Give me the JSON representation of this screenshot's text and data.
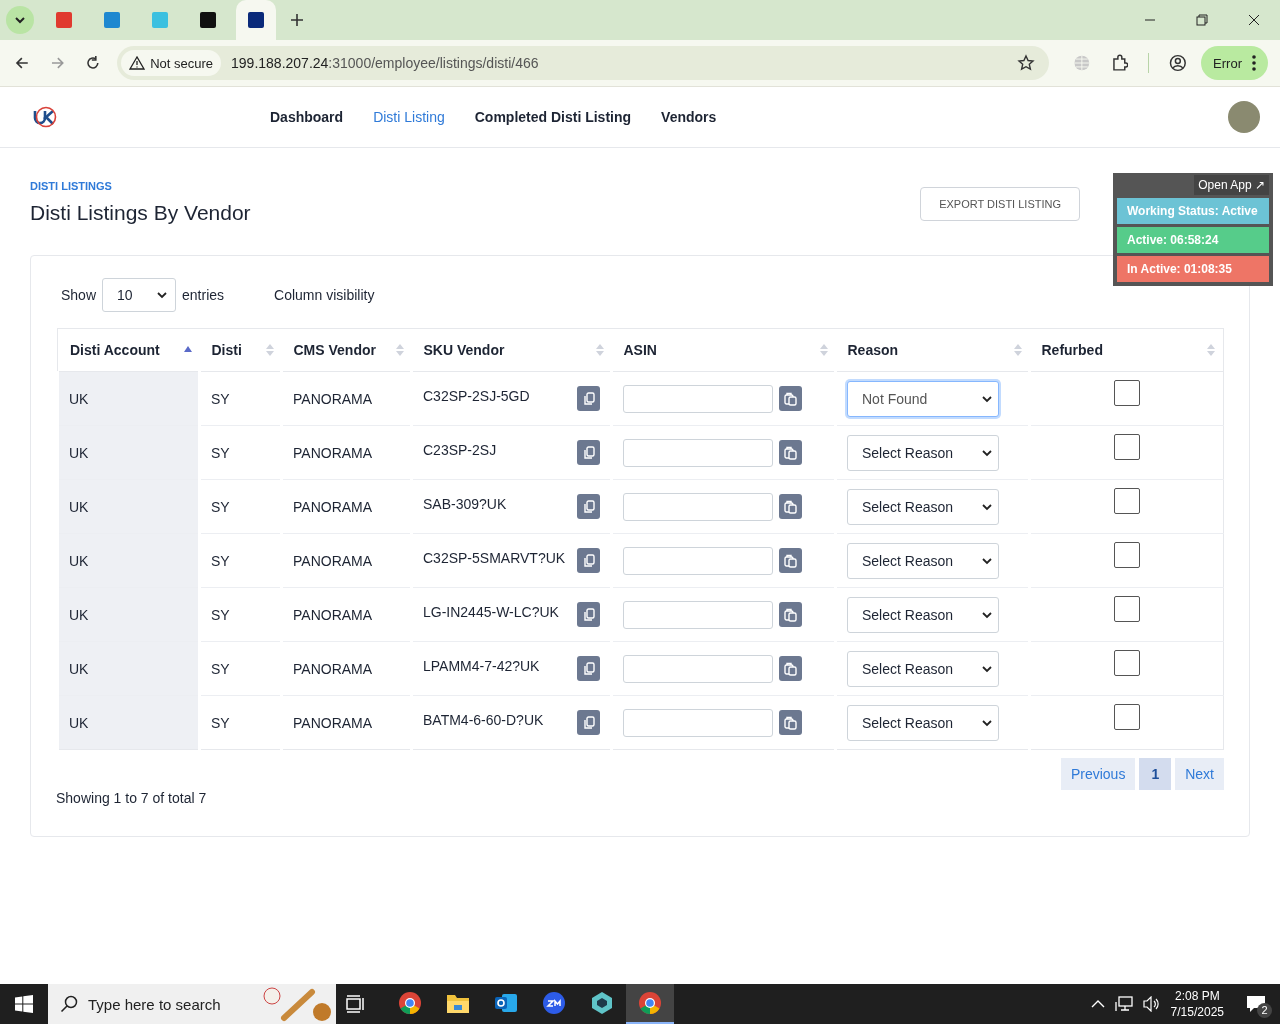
{
  "browser": {
    "tabs": [
      {
        "selected": false
      },
      {
        "selected": false
      },
      {
        "selected": false
      },
      {
        "selected": false
      },
      {
        "selected": true
      }
    ],
    "security": "Not secure",
    "url_host": "199.188.207.24",
    "url_path": ":31000/employee/listings/disti/466",
    "profile": "Error"
  },
  "nav": {
    "items": [
      {
        "label": "Dashboard",
        "selected": false
      },
      {
        "label": "Disti Listing",
        "selected": true
      },
      {
        "label": "Completed Disti Listing",
        "selected": false
      },
      {
        "label": "Vendors",
        "selected": false
      }
    ]
  },
  "page": {
    "breadcrumb": "DISTI LISTINGS",
    "title": "Disti Listings By Vendor",
    "export_button": "EXPORT DISTI LISTING"
  },
  "tracker": {
    "open_app": "Open App ↗",
    "statuses": [
      {
        "text": "Working Status: Active",
        "color": "#6cc3d5"
      },
      {
        "text": "Active: 06:58:24",
        "color": "#56cc8a"
      },
      {
        "text": "In Active: 01:08:35",
        "color": "#ee7566"
      }
    ]
  },
  "table": {
    "show_label": "Show",
    "entries_value": "10",
    "entries_label": "entries",
    "column_visibility": "Column visibility",
    "columns": [
      {
        "label": "Disti Account",
        "sorted": true
      },
      {
        "label": "Disti",
        "sorted": false
      },
      {
        "label": "CMS Vendor",
        "sorted": false
      },
      {
        "label": "SKU Vendor",
        "sorted": false
      },
      {
        "label": "ASIN",
        "sorted": false
      },
      {
        "label": "Reason",
        "sorted": false
      },
      {
        "label": "Refurbed",
        "sorted": false
      }
    ],
    "rows": [
      {
        "disti_account": "UK",
        "disti": "SY",
        "cms_vendor": "PANORAMA",
        "sku_vendor": "C32SP-2SJ-5GD",
        "reason": "Not Found",
        "reason_focused": true,
        "refurbed": false
      },
      {
        "disti_account": "UK",
        "disti": "SY",
        "cms_vendor": "PANORAMA",
        "sku_vendor": "C23SP-2SJ",
        "reason": "Select Reason",
        "reason_focused": false,
        "refurbed": false
      },
      {
        "disti_account": "UK",
        "disti": "SY",
        "cms_vendor": "PANORAMA",
        "sku_vendor": "SAB-309?UK",
        "reason": "Select Reason",
        "reason_focused": false,
        "refurbed": false
      },
      {
        "disti_account": "UK",
        "disti": "SY",
        "cms_vendor": "PANORAMA",
        "sku_vendor": "C32SP-5SMARVT?UK",
        "reason": "Select Reason",
        "reason_focused": false,
        "refurbed": false
      },
      {
        "disti_account": "UK",
        "disti": "SY",
        "cms_vendor": "PANORAMA",
        "sku_vendor": "LG-IN2445-W-LC?UK",
        "reason": "Select Reason",
        "reason_focused": false,
        "refurbed": false
      },
      {
        "disti_account": "UK",
        "disti": "SY",
        "cms_vendor": "PANORAMA",
        "sku_vendor": "LPAMM4-7-42?UK",
        "reason": "Select Reason",
        "reason_focused": false,
        "refurbed": false
      },
      {
        "disti_account": "UK",
        "disti": "SY",
        "cms_vendor": "PANORAMA",
        "sku_vendor": "BATM4-6-60-D?UK",
        "reason": "Select Reason",
        "reason_focused": false,
        "refurbed": false
      }
    ],
    "info": "Showing 1 to 7 of total 7",
    "previous": "Previous",
    "pages": [
      {
        "label": "1",
        "selected": true
      }
    ],
    "next": "Next"
  },
  "taskbar": {
    "search_placeholder": "Type here to search",
    "apps": [
      {
        "kind": "chrome",
        "selected": false
      },
      {
        "kind": "folder",
        "selected": false
      },
      {
        "kind": "mail",
        "selected": false
      },
      {
        "kind": "video",
        "selected": false
      },
      {
        "kind": "hexagon",
        "selected": false
      },
      {
        "kind": "chrome",
        "selected": true
      }
    ],
    "time": "2:08 PM",
    "date": "7/15/2025",
    "notifications": "2"
  }
}
